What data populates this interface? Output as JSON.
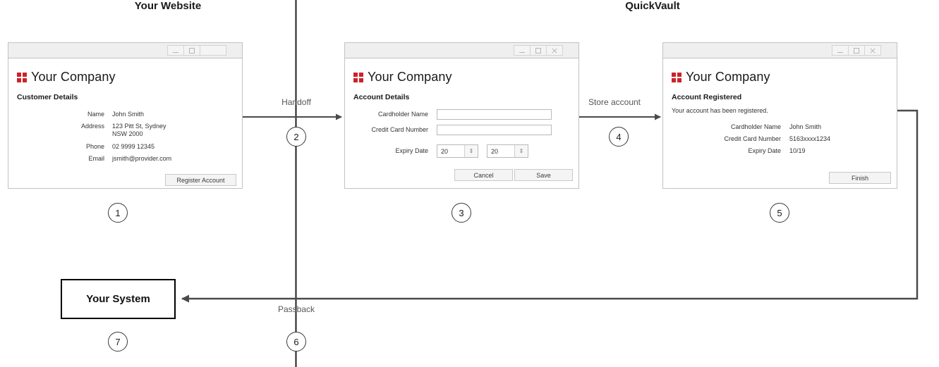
{
  "lanes": [
    {
      "title": "Your Website"
    },
    {
      "title": "QuickVault"
    }
  ],
  "flows": [
    {
      "label": "Handoff",
      "step": "2"
    },
    {
      "label": "Store account",
      "step": "4"
    },
    {
      "label": "Passback",
      "step": "6"
    }
  ],
  "steps": {
    "s1": "1",
    "s2": "2",
    "s3": "3",
    "s4": "4",
    "s5": "5",
    "s6": "6",
    "s7": "7"
  },
  "brand": {
    "name": "Your Company",
    "mark": "four-squares-logo",
    "color": "#cc2229"
  },
  "window1": {
    "controls": {
      "minimize": "minimize-icon",
      "maximize": "maximize-icon",
      "extra": "blank-button"
    },
    "section": "Customer Details",
    "fields": [
      {
        "label": "Name",
        "value": "John Smith"
      },
      {
        "label": "Address",
        "value": "123 Pitt St, Sydney\nNSW 2000"
      },
      {
        "label": "Phone",
        "value": "02 9999 12345"
      },
      {
        "label": "Email",
        "value": "jsmith@provider.com"
      }
    ],
    "button": "Register Account"
  },
  "window2": {
    "controls": {
      "minimize": "minimize-icon",
      "maximize": "maximize-icon",
      "close": "close-icon"
    },
    "section": "Account Details",
    "fields": [
      {
        "label": "Cardholder Name",
        "value": "",
        "placeholder": ""
      },
      {
        "label": "Credit Card Number",
        "value": "",
        "placeholder": ""
      }
    ],
    "expiry": {
      "label": "Expiry Date",
      "month_value": "20",
      "year_value": "20",
      "stepper_icon": "up-down-arrows-icon"
    },
    "buttons": {
      "cancel": "Cancel",
      "save": "Save"
    }
  },
  "window3": {
    "controls": {
      "minimize": "minimize-icon",
      "maximize": "maximize-icon",
      "close": "close-icon"
    },
    "section": "Account Registered",
    "message": "Your account has been registered.",
    "fields": [
      {
        "label": "Cardholder Name",
        "value": "John Smith"
      },
      {
        "label": "Credit Card Number",
        "value": "5163xxxx1234"
      },
      {
        "label": "Expiry Date",
        "value": "10/19"
      }
    ],
    "button": "Finish"
  },
  "system": {
    "label": "Your System"
  }
}
